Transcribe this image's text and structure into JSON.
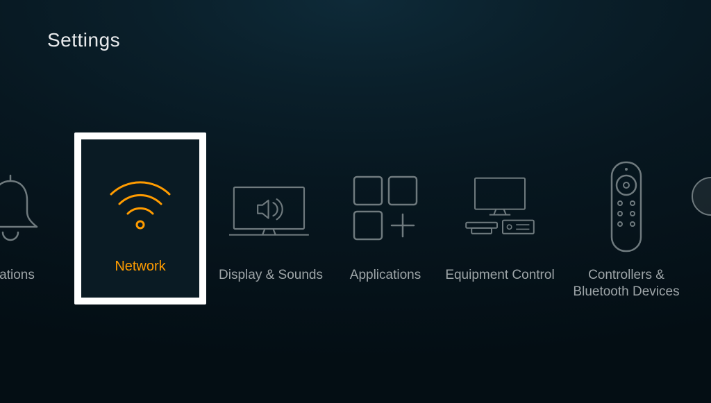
{
  "colors": {
    "accent": "#ff9c00",
    "inactive_stroke": "#6f7a7e",
    "text_muted": "#9ea5a8"
  },
  "page_title": "Settings",
  "tiles": {
    "notifications": {
      "label": "fications",
      "icon": "bell-icon",
      "selected": false
    },
    "network": {
      "label": "Network",
      "icon": "wifi-icon",
      "selected": true
    },
    "display": {
      "label": "Display & Sounds",
      "icon": "tv-sound-icon",
      "selected": false
    },
    "applications": {
      "label": "Applications",
      "icon": "apps-grid-icon",
      "selected": false
    },
    "equipment": {
      "label": "Equipment Control",
      "icon": "equipment-icon",
      "selected": false
    },
    "controllers": {
      "label": "Controllers & Bluetooth Devices",
      "icon": "remote-icon",
      "selected": false
    }
  }
}
